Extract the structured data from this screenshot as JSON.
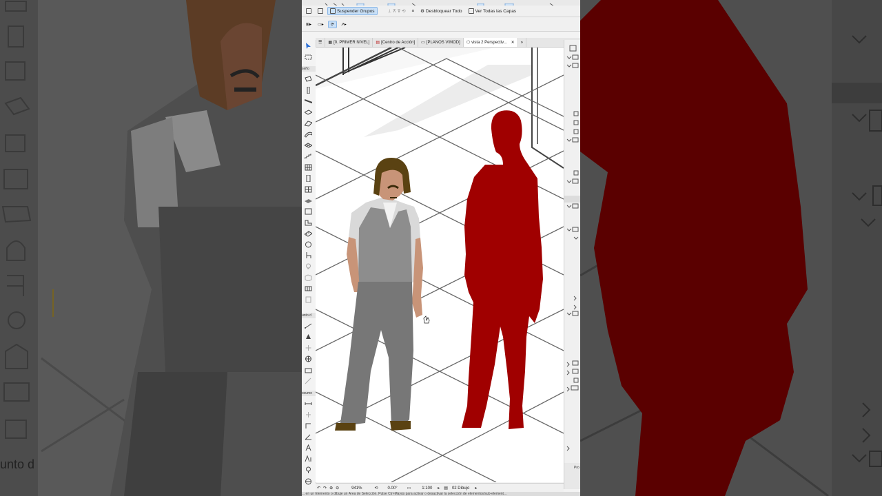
{
  "toolbar": {
    "suspend_groups": "Suspender Grupos",
    "unlock_all": "Desbloquear Todo",
    "view_all_layers": "Ver Todas las Capas"
  },
  "toolbox": {
    "section_design": "seño",
    "section_point": "unto d",
    "section_document": "ocume"
  },
  "tabs": [
    {
      "label": "[0. PRIMER NIVEL]",
      "icon": "floor-plan-icon"
    },
    {
      "label": "[Centro de Acción]",
      "icon": "action-center-icon"
    },
    {
      "label": "[PLANOS VIMOD]",
      "icon": "layout-icon"
    },
    {
      "label": "vista 2 Perspectiv...",
      "icon": "3d-view-icon"
    }
  ],
  "status": {
    "zoom": "941%",
    "angle": "0.00°",
    "scale": "1:100",
    "pen_set": "02 Dibujo"
  },
  "message": "... en un Elemento o dibuje un Área de Selección. Pulse Ctrl-Mayús para activar o desactivar la selección de elementos/sub-element...",
  "background_label": "unto d",
  "right_panel": {
    "label": "Pro"
  },
  "colors": {
    "figure_red": "#a00000",
    "vest_gray": "#8d8d8d",
    "pants_gray": "#777777",
    "hair_brown": "#5a4212",
    "skin": "#c89478",
    "selection_blue": "#c9e0f7"
  }
}
